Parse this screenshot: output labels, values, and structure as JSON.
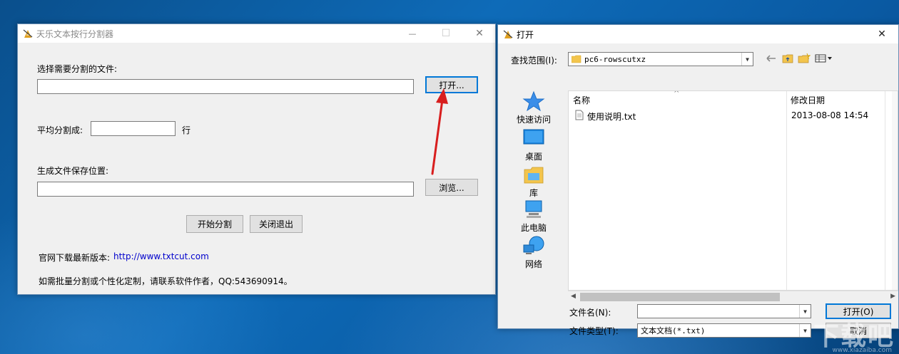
{
  "main_window": {
    "title": "天乐文本按行分割器",
    "caption": {
      "minimize": "—",
      "maximize": "☐",
      "close": "✕"
    },
    "select_file_label": "选择需要分割的文件:",
    "select_file_value": "",
    "open_button": "打开...",
    "split_label": "平均分割成:",
    "split_value": "",
    "split_unit": "行",
    "save_label": "生成文件保存位置:",
    "save_value": "",
    "browse_button": "浏览...",
    "start_button": "开始分割",
    "exit_button": "关闭退出",
    "website_label": "官网下载最新版本:",
    "website_url": "http://www.txtcut.com",
    "contact_text": "如需批量分割或个性化定制，请联系软件作者，QQ:543690914。"
  },
  "open_dialog": {
    "title": "打开",
    "close": "✕",
    "lookin_label": "查找范围(I):",
    "lookin_value": "pc6-rowscutxz",
    "places": [
      {
        "label": "快速访问",
        "icon": "star-icon"
      },
      {
        "label": "桌面",
        "icon": "desktop-icon"
      },
      {
        "label": "库",
        "icon": "library-icon"
      },
      {
        "label": "此电脑",
        "icon": "computer-icon"
      },
      {
        "label": "网络",
        "icon": "network-icon"
      }
    ],
    "columns": {
      "name": "名称",
      "modified": "修改日期"
    },
    "files": [
      {
        "name": "使用说明.txt",
        "modified": "2013-08-08 14:54"
      }
    ],
    "filename_label": "文件名(N):",
    "filename_value": "",
    "filetype_label": "文件类型(T):",
    "filetype_value": "文本文档(*.txt)",
    "open_button": "打开(O)",
    "cancel_button": "取消"
  },
  "watermark": {
    "text": "下载吧",
    "url": "www.xiazaiba.com"
  },
  "colors": {
    "annotation_arrow": "#d81e1e",
    "link": "#0000cc",
    "focus_border": "#0078d7"
  }
}
